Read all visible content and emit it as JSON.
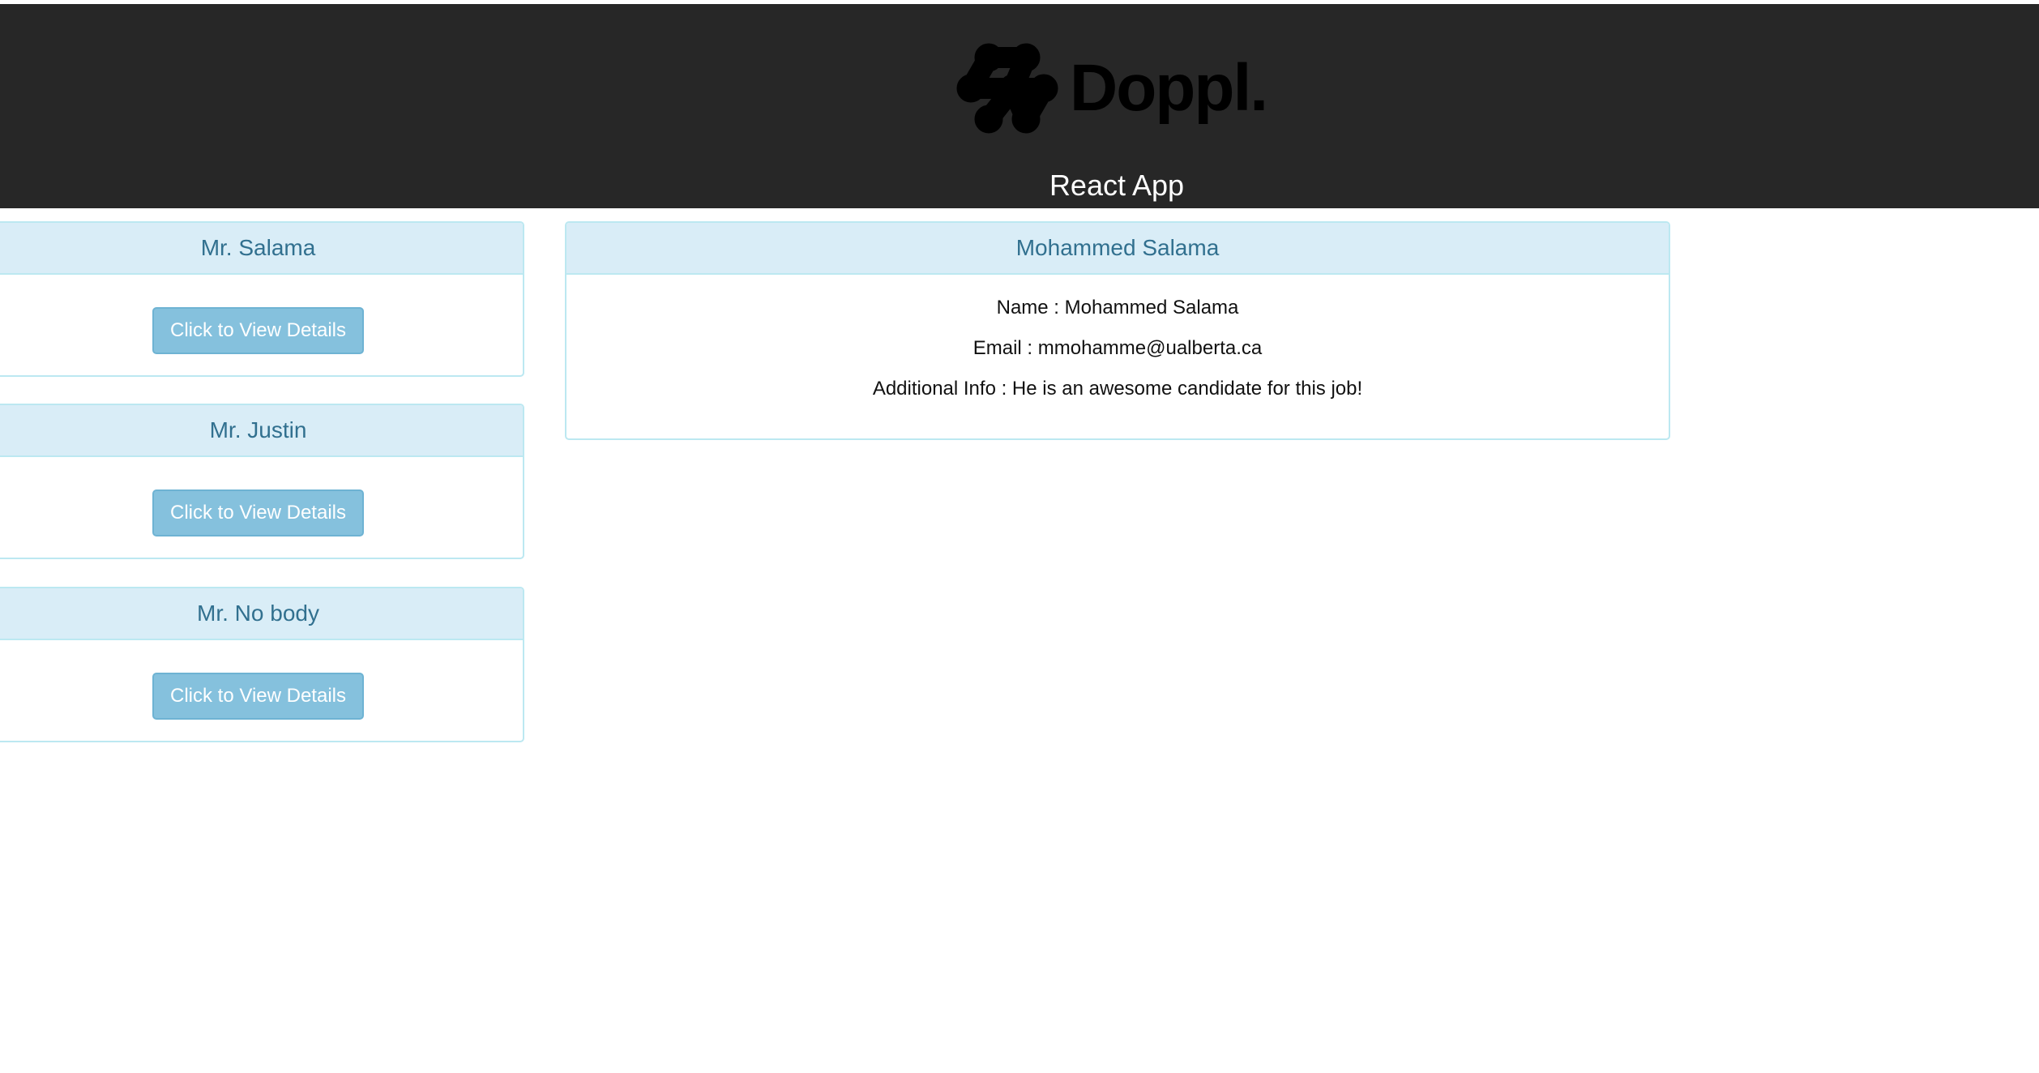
{
  "header": {
    "logo_text": "Doppl.",
    "title": "React App"
  },
  "candidates": [
    {
      "name": "Mr. Salama",
      "button_label": "Click to View Details"
    },
    {
      "name": "Mr. Justin",
      "button_label": "Click to View Details"
    },
    {
      "name": "Mr. No body",
      "button_label": "Click to View Details"
    }
  ],
  "details": {
    "heading": "Mohammed Salama",
    "name_line": "Name : Mohammed Salama",
    "email_line": "Email : mmohamme@ualberta.ca",
    "info_line": "Additional Info : He is an awesome candidate for this job!"
  },
  "colors": {
    "header_bg": "#272727",
    "panel_heading_bg": "#d9edf7",
    "panel_heading_text": "#31708f",
    "panel_border": "#bce8f1",
    "button_bg": "#85c1dd"
  }
}
